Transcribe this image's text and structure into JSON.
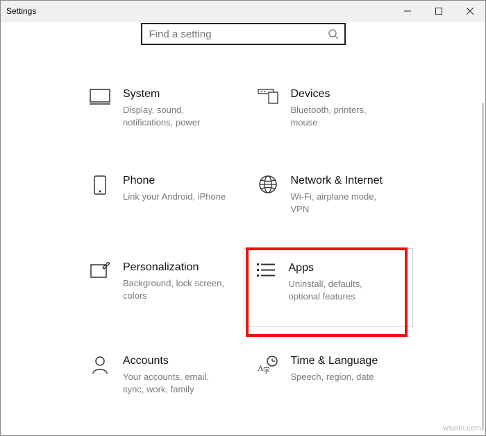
{
  "window": {
    "title": "Settings"
  },
  "search": {
    "placeholder": "Find a setting"
  },
  "tiles": {
    "system": {
      "title": "System",
      "desc": "Display, sound, notifications, power"
    },
    "devices": {
      "title": "Devices",
      "desc": "Bluetooth, printers, mouse"
    },
    "phone": {
      "title": "Phone",
      "desc": "Link your Android, iPhone"
    },
    "network": {
      "title": "Network & Internet",
      "desc": "Wi-Fi, airplane mode, VPN"
    },
    "personalization": {
      "title": "Personalization",
      "desc": "Background, lock screen, colors"
    },
    "apps": {
      "title": "Apps",
      "desc": "Uninstall, defaults, optional features"
    },
    "accounts": {
      "title": "Accounts",
      "desc": "Your accounts, email, sync, work, family"
    },
    "time": {
      "title": "Time & Language",
      "desc": "Speech, region, date"
    }
  },
  "watermark": "wsxdn.com"
}
